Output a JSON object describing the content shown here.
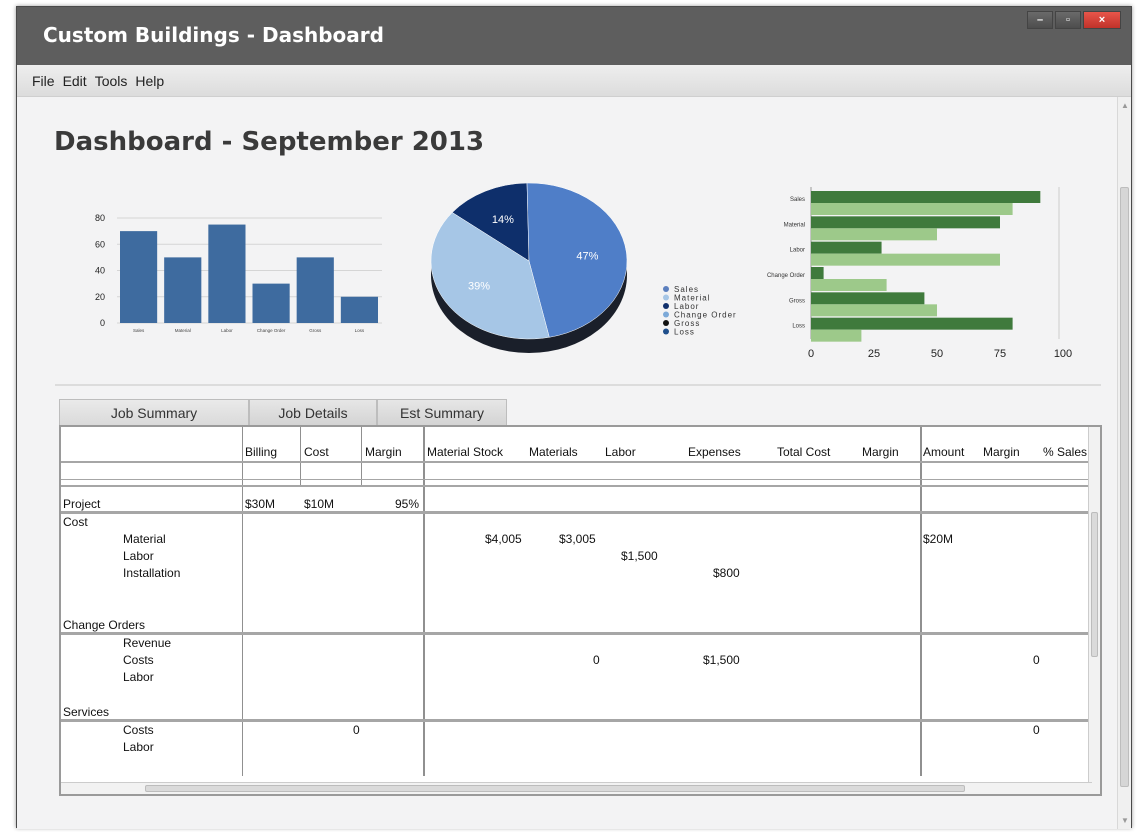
{
  "window": {
    "title": "Custom Buildings - Dashboard",
    "controls": {
      "minimize": "–",
      "maximize": "▫",
      "close": "×"
    }
  },
  "menu": [
    "File",
    "Edit",
    "Tools",
    "Help"
  ],
  "dashboard_title": "Dashboard - September 2013",
  "colors": {
    "bar_blue": "#3e6b9f",
    "bar_dark_green": "#3f7a3c",
    "bar_light_green": "#9dc98a"
  },
  "chart_data": [
    {
      "type": "bar",
      "categories": [
        "Sales",
        "Material",
        "Labor",
        "Change Order",
        "Gross",
        "Loss"
      ],
      "values": [
        70,
        50,
        75,
        30,
        50,
        20
      ],
      "yticks": [
        "0",
        "20",
        "40",
        "60",
        "80"
      ],
      "ylim": [
        0,
        80
      ],
      "grid": true
    },
    {
      "type": "pie",
      "categories": [
        "Sales",
        "Material",
        "Labor",
        "Change Order",
        "Gross",
        "Loss"
      ],
      "labels": [
        "47%",
        "39%",
        "14%"
      ],
      "values": [
        47,
        39,
        14
      ],
      "colors": [
        "#4f7ec8",
        "#a6c6e6",
        "#0e2f6b"
      ],
      "legend_colors": [
        "#5b7fbe",
        "#a6c6e6",
        "#10306c",
        "#7ca9d8",
        "#111111",
        "#1f4f8c"
      ],
      "legend_placement": "right"
    },
    {
      "type": "bar",
      "orientation": "horizontal",
      "categories": [
        "Sales",
        "Material",
        "Labor",
        "Change Order",
        "Gross",
        "Loss"
      ],
      "series": [
        {
          "values": [
            91,
            75,
            28,
            5,
            45,
            80
          ]
        },
        {
          "values": [
            80,
            50,
            75,
            30,
            50,
            20
          ]
        }
      ],
      "xticks": [
        "0",
        "25",
        "50",
        "75",
        "100"
      ],
      "xlim": [
        0,
        100
      ]
    }
  ],
  "tabs": [
    "Job Summary",
    "Job Details",
    "Est Summary"
  ],
  "table": {
    "headers": [
      "Billing",
      "Cost",
      "Margin",
      "Material Stock",
      "Materials",
      "Labor",
      "Expenses",
      "Total Cost",
      "Margin",
      "Amount",
      "Margin",
      "% Sales"
    ],
    "project": {
      "label": "Project",
      "billing": "$30M",
      "cost": "$10M",
      "margin": "95%"
    },
    "cost_section": {
      "label": "Cost",
      "rows": [
        "Material",
        "Labor",
        "Installation"
      ],
      "material_stock": "$4,005",
      "materials": "$3,005",
      "labor": "$1,500",
      "expenses": "$800",
      "amount": "$20M"
    },
    "change_orders": {
      "label": "Change Orders",
      "rows": [
        "Revenue",
        "Costs",
        "Labor"
      ],
      "materials": "0",
      "expenses": "$1,500",
      "pct_sales": "0"
    },
    "services": {
      "label": "Services",
      "rows": [
        "Costs",
        "Labor"
      ],
      "margin": "0",
      "pct_sales": "0"
    }
  }
}
